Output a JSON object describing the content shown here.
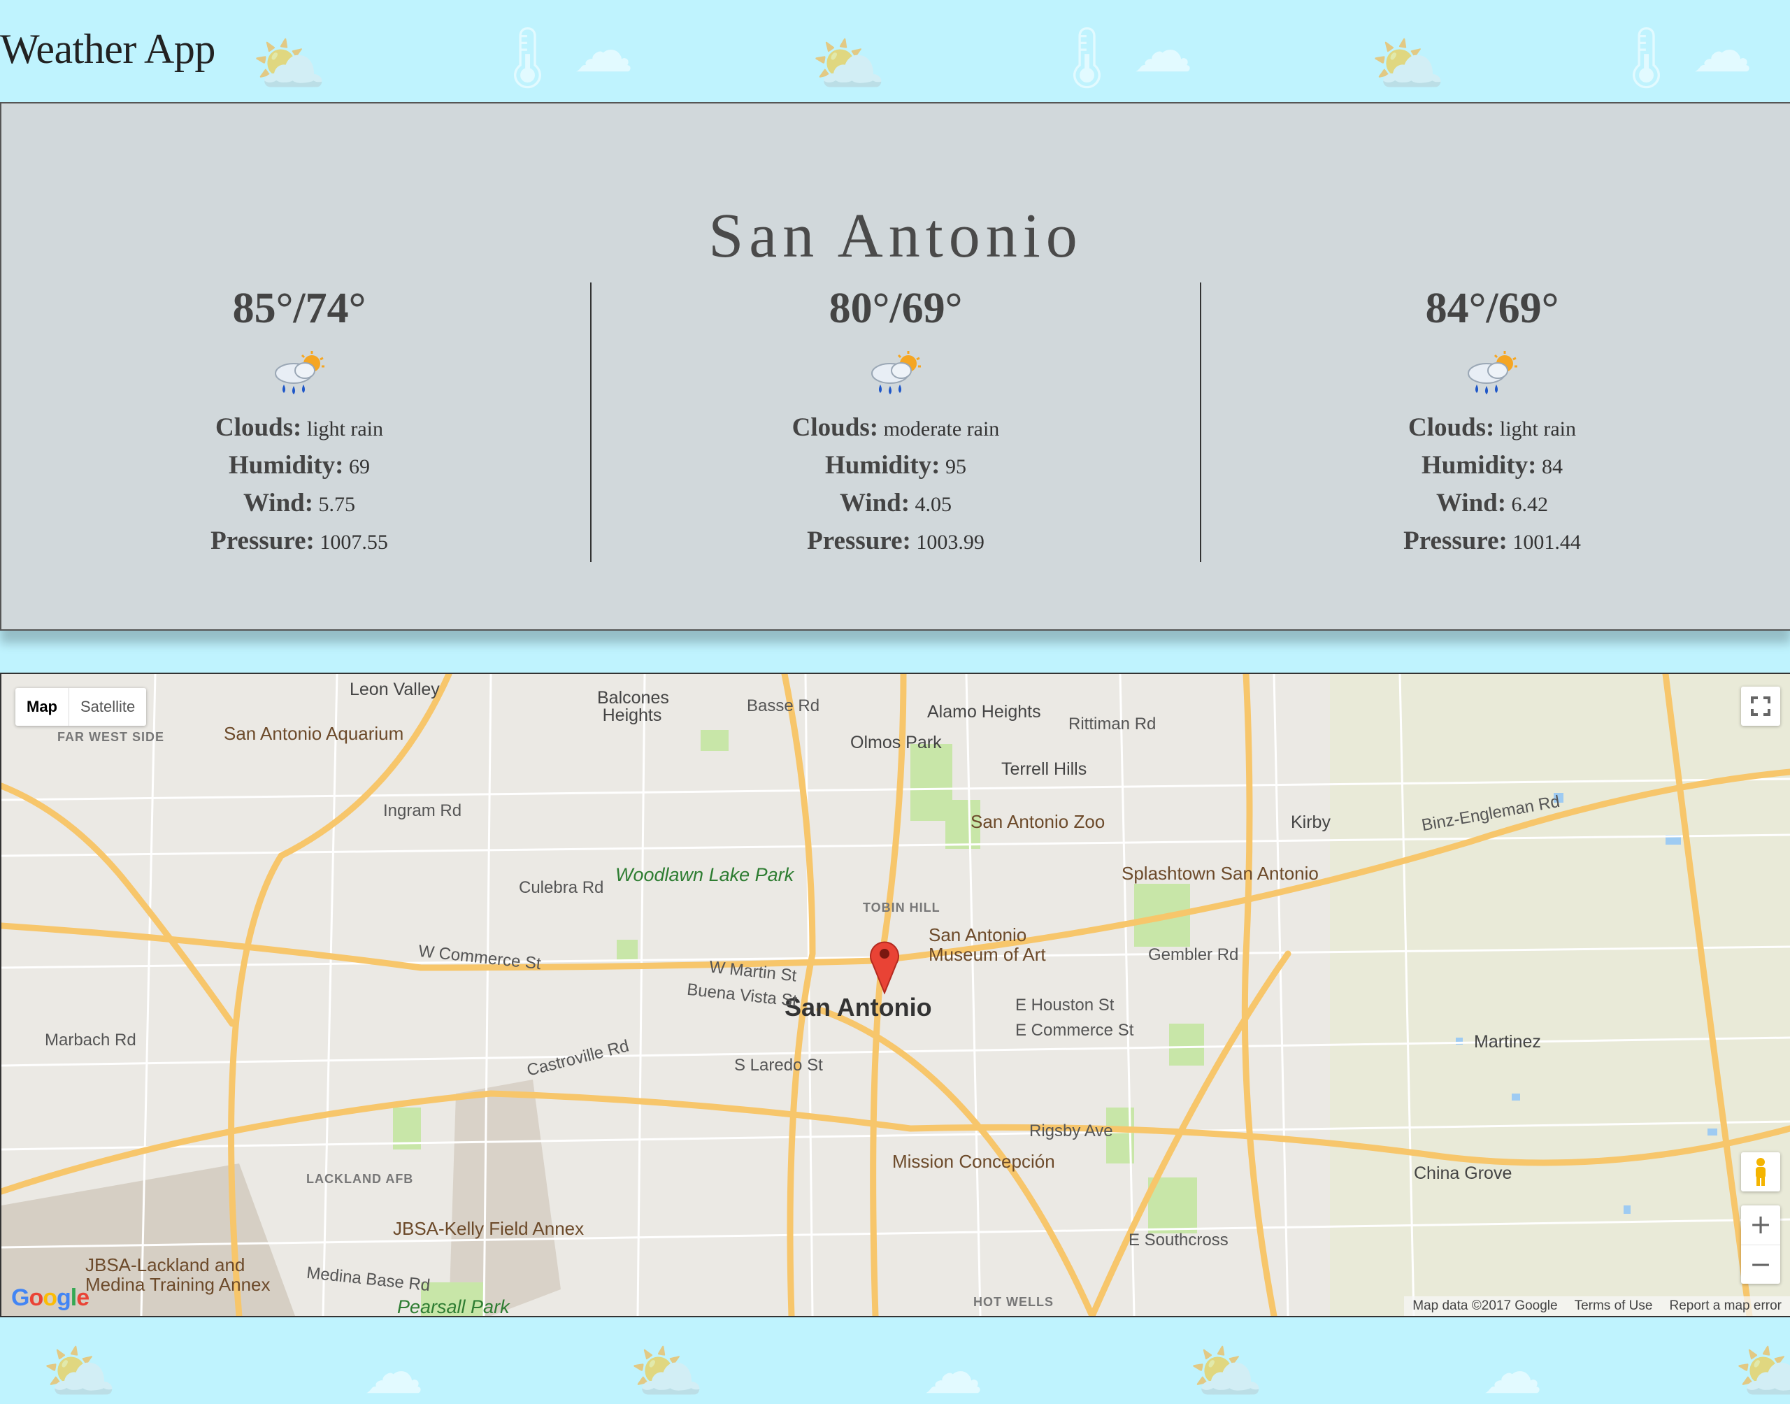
{
  "app": {
    "title": "Weather App"
  },
  "city": "San Antonio",
  "forecasts": [
    {
      "temp": "85°/74°",
      "icon": "rain-cloud-sun-icon",
      "clouds_label": "Clouds:",
      "clouds": "light rain",
      "humidity_label": "Humidity:",
      "humidity": "69",
      "wind_label": "Wind:",
      "wind": "5.75",
      "pressure_label": "Pressure:",
      "pressure": "1007.55"
    },
    {
      "temp": "80°/69°",
      "icon": "rain-cloud-sun-icon",
      "clouds_label": "Clouds:",
      "clouds": "moderate rain",
      "humidity_label": "Humidity:",
      "humidity": "95",
      "wind_label": "Wind:",
      "wind": "4.05",
      "pressure_label": "Pressure:",
      "pressure": "1003.99"
    },
    {
      "temp": "84°/69°",
      "icon": "rain-cloud-sun-icon",
      "clouds_label": "Clouds:",
      "clouds": "light rain",
      "humidity_label": "Humidity:",
      "humidity": "84",
      "wind_label": "Wind:",
      "wind": "6.42",
      "pressure_label": "Pressure:",
      "pressure": "1001.44"
    }
  ],
  "map": {
    "type_options": [
      "Map",
      "Satellite"
    ],
    "main_label": "San Antonio",
    "labels": {
      "leon_valley": "Leon Valley",
      "balcones_heights": "Balcones Heights",
      "alamo_heights": "Alamo Heights",
      "olmos_park": "Olmos Park",
      "terrell_hills": "Terrell Hills",
      "kirby": "Kirby",
      "sa_aquarium": "San Antonio Aquarium",
      "far_west_side": "FAR WEST SIDE",
      "sa_zoo": "San Antonio Zoo",
      "splashtown": "Splashtown San Antonio",
      "woodlawn": "Woodlawn Lake Park",
      "tobin_hill": "TOBIN HILL",
      "museum_1": "San Antonio",
      "museum_2": "Museum of Art",
      "martinez": "Martinez",
      "mission": "Mission Concepción",
      "china_grove": "China Grove",
      "lackland_afb": "LACKLAND AFB",
      "kelly": "JBSA-Kelly Field Annex",
      "lackland_1": "JBSA-Lackland and",
      "lackland_2": "Medina Training Annex",
      "pearsall": "Pearsall Park",
      "hot_wells": "HOT WELLS",
      "w_commerce": "W Commerce St",
      "culebra": "Culebra Rd",
      "ingram": "Ingram Rd",
      "e_houston": "E Houston St",
      "e_commerce": "E Commerce St",
      "marbach": "Marbach Rd",
      "castroville": "Castroville Rd",
      "rigsby": "Rigsby Ave",
      "s_laredo": "S Laredo St",
      "buena_vista": "Buena Vista St",
      "w_martin": "W Martin St",
      "gembler": "Gembler Rd",
      "e_southcross": "E Southcross",
      "medina_base": "Medina Base Rd",
      "basse": "Basse Rd",
      "rittiman": "Rittiman Rd",
      "binz": "Binz-Engleman Rd"
    },
    "attribution": [
      "Map data ©2017 Google",
      "Terms of Use",
      "Report a map error"
    ],
    "logo": "Google",
    "zoom_in": "+",
    "zoom_out": "−",
    "colors": {
      "highway": "#f7c66b",
      "water": "#9ecbf2",
      "park": "#c8e6a8",
      "pin": "#e94335"
    }
  }
}
